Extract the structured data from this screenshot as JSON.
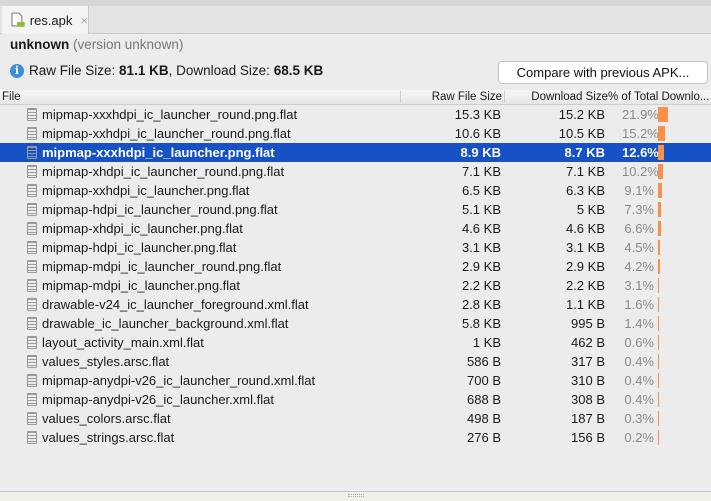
{
  "tab": {
    "label": "res.apk",
    "close": "×",
    "icon": "android-file-icon"
  },
  "app": {
    "name": "unknown",
    "version": "(version unknown)"
  },
  "summary": {
    "raw_label": "Raw File Size:",
    "raw_value": "81.1 KB",
    "sep": ",",
    "download_label": "Download Size:",
    "download_value": "68.5 KB",
    "icon": "info-icon"
  },
  "compare_button": "Compare with previous APK...",
  "columns": [
    "File",
    "Raw File Size",
    "Download Size",
    "% of Total Downlo..."
  ],
  "colors": {
    "selection": "#1652c6",
    "bar": "#f7904a"
  },
  "rows": [
    {
      "name": "mipmap-xxxhdpi_ic_launcher_round.png.flat",
      "raw": "15.3 KB",
      "download": "15.2 KB",
      "percent": "21.9%",
      "pct": 21.9
    },
    {
      "name": "mipmap-xxhdpi_ic_launcher_round.png.flat",
      "raw": "10.6 KB",
      "download": "10.5 KB",
      "percent": "15.2%",
      "pct": 15.2
    },
    {
      "name": "mipmap-xxxhdpi_ic_launcher.png.flat",
      "raw": "8.9 KB",
      "download": "8.7 KB",
      "percent": "12.6%",
      "pct": 12.6,
      "selected": true
    },
    {
      "name": "mipmap-xhdpi_ic_launcher_round.png.flat",
      "raw": "7.1 KB",
      "download": "7.1 KB",
      "percent": "10.2%",
      "pct": 10.2
    },
    {
      "name": "mipmap-xxhdpi_ic_launcher.png.flat",
      "raw": "6.5 KB",
      "download": "6.3 KB",
      "percent": "9.1%",
      "pct": 9.1
    },
    {
      "name": "mipmap-hdpi_ic_launcher_round.png.flat",
      "raw": "5.1 KB",
      "download": "5 KB",
      "percent": "7.3%",
      "pct": 7.3
    },
    {
      "name": "mipmap-xhdpi_ic_launcher.png.flat",
      "raw": "4.6 KB",
      "download": "4.6 KB",
      "percent": "6.6%",
      "pct": 6.6
    },
    {
      "name": "mipmap-hdpi_ic_launcher.png.flat",
      "raw": "3.1 KB",
      "download": "3.1 KB",
      "percent": "4.5%",
      "pct": 4.5
    },
    {
      "name": "mipmap-mdpi_ic_launcher_round.png.flat",
      "raw": "2.9 KB",
      "download": "2.9 KB",
      "percent": "4.2%",
      "pct": 4.2
    },
    {
      "name": "mipmap-mdpi_ic_launcher.png.flat",
      "raw": "2.2 KB",
      "download": "2.2 KB",
      "percent": "3.1%",
      "pct": 3.1
    },
    {
      "name": "drawable-v24_ic_launcher_foreground.xml.flat",
      "raw": "2.8 KB",
      "download": "1.1 KB",
      "percent": "1.6%",
      "pct": 1.6
    },
    {
      "name": "drawable_ic_launcher_background.xml.flat",
      "raw": "5.8 KB",
      "download": "995 B",
      "percent": "1.4%",
      "pct": 1.4
    },
    {
      "name": "layout_activity_main.xml.flat",
      "raw": "1 KB",
      "download": "462 B",
      "percent": "0.6%",
      "pct": 0.6
    },
    {
      "name": "values_styles.arsc.flat",
      "raw": "586 B",
      "download": "317 B",
      "percent": "0.4%",
      "pct": 0.4
    },
    {
      "name": "mipmap-anydpi-v26_ic_launcher_round.xml.flat",
      "raw": "700 B",
      "download": "310 B",
      "percent": "0.4%",
      "pct": 0.4
    },
    {
      "name": "mipmap-anydpi-v26_ic_launcher.xml.flat",
      "raw": "688 B",
      "download": "308 B",
      "percent": "0.4%",
      "pct": 0.4
    },
    {
      "name": "values_colors.arsc.flat",
      "raw": "498 B",
      "download": "187 B",
      "percent": "0.3%",
      "pct": 0.3
    },
    {
      "name": "values_strings.arsc.flat",
      "raw": "276 B",
      "download": "156 B",
      "percent": "0.2%",
      "pct": 0.2
    }
  ]
}
